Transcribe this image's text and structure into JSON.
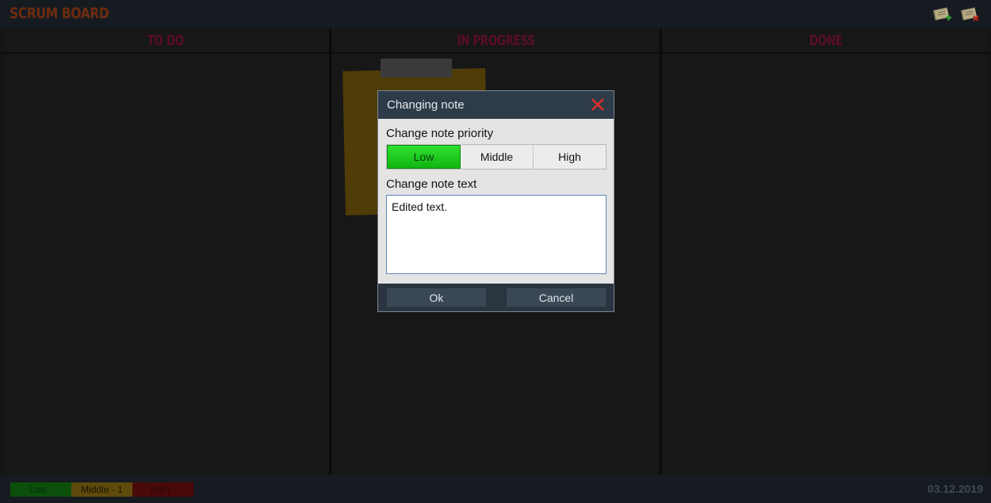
{
  "app": {
    "title": "SCRUM BOARD"
  },
  "toolbar": {
    "add_note_icon": "add-note-icon",
    "delete_note_icon": "delete-note-icon"
  },
  "columns": [
    {
      "title": "TO DO"
    },
    {
      "title": "IN PROGRESS"
    },
    {
      "title": "DONE"
    }
  ],
  "dialog": {
    "title": "Changing note",
    "priority_label": "Change note priority",
    "priority_options": [
      "Low",
      "Middle",
      "High"
    ],
    "selected_priority": "Low",
    "text_label": "Change note text",
    "text_value": "Edited text.",
    "ok_label": "Ok",
    "cancel_label": "Cancel"
  },
  "footer": {
    "legend": [
      {
        "label": "Low -",
        "color": "#0b4f0b"
      },
      {
        "label": "Middle - 1",
        "color": "#5e4a0c"
      },
      {
        "label": "High -",
        "color": "#4a0909"
      }
    ],
    "date": "03.12.2019"
  },
  "colors": {
    "accent_green": "#11b511",
    "title_color": "#6e2c10",
    "column_title_color": "#5a0e24",
    "note_color": "#4f3c07"
  }
}
